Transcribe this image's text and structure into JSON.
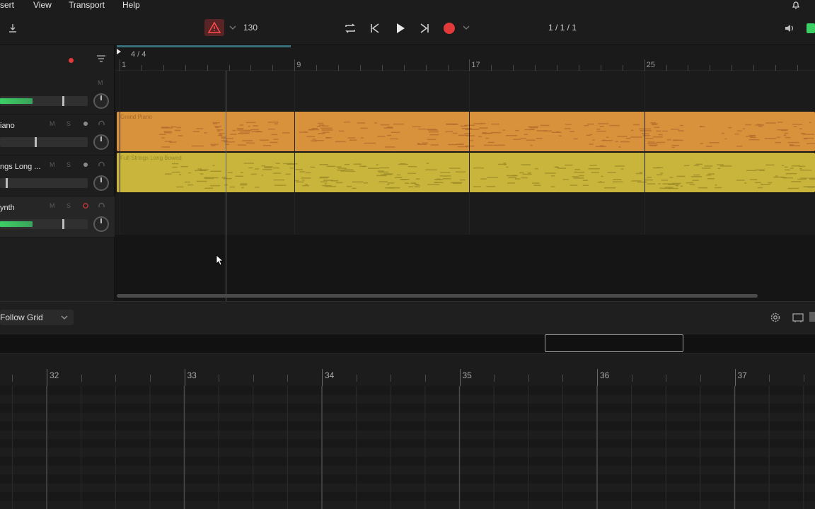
{
  "menu": {
    "items": [
      "sert",
      "View",
      "Transport",
      "Help"
    ]
  },
  "toolbar": {
    "tempo": "130",
    "position": "1 / 1 / 1",
    "colors": {
      "record": "#e23a3a",
      "warning_bg": "#5a2326",
      "warning_fg": "#ff4d4d",
      "meter_green": "#3ccf66"
    }
  },
  "timeline": {
    "time_signature": "4 / 4",
    "bars": [
      "1",
      "9",
      "17",
      "25"
    ]
  },
  "tracks": [
    {
      "name": "",
      "mute": "M",
      "solo": "",
      "level": 0.37
    },
    {
      "name": "iano",
      "mute": "M",
      "solo": "S",
      "level": 0.0
    },
    {
      "name": "ngs Long ...",
      "mute": "M",
      "solo": "S",
      "level": 0.0
    },
    {
      "name": "ynth",
      "mute": "M",
      "solo": "S",
      "level": 0.37
    }
  ],
  "clips": [
    {
      "name": "Grand Piano",
      "color": "#d8923c",
      "text_color": "#a86a28"
    },
    {
      "name": "Full Strings Long Bowed",
      "color": "#c9b43c",
      "text_color": "#968a2a"
    }
  ],
  "bottom": {
    "grid_mode": "Follow Grid"
  },
  "piano_roll": {
    "bars": [
      "32",
      "33",
      "34",
      "35",
      "36",
      "37"
    ]
  }
}
